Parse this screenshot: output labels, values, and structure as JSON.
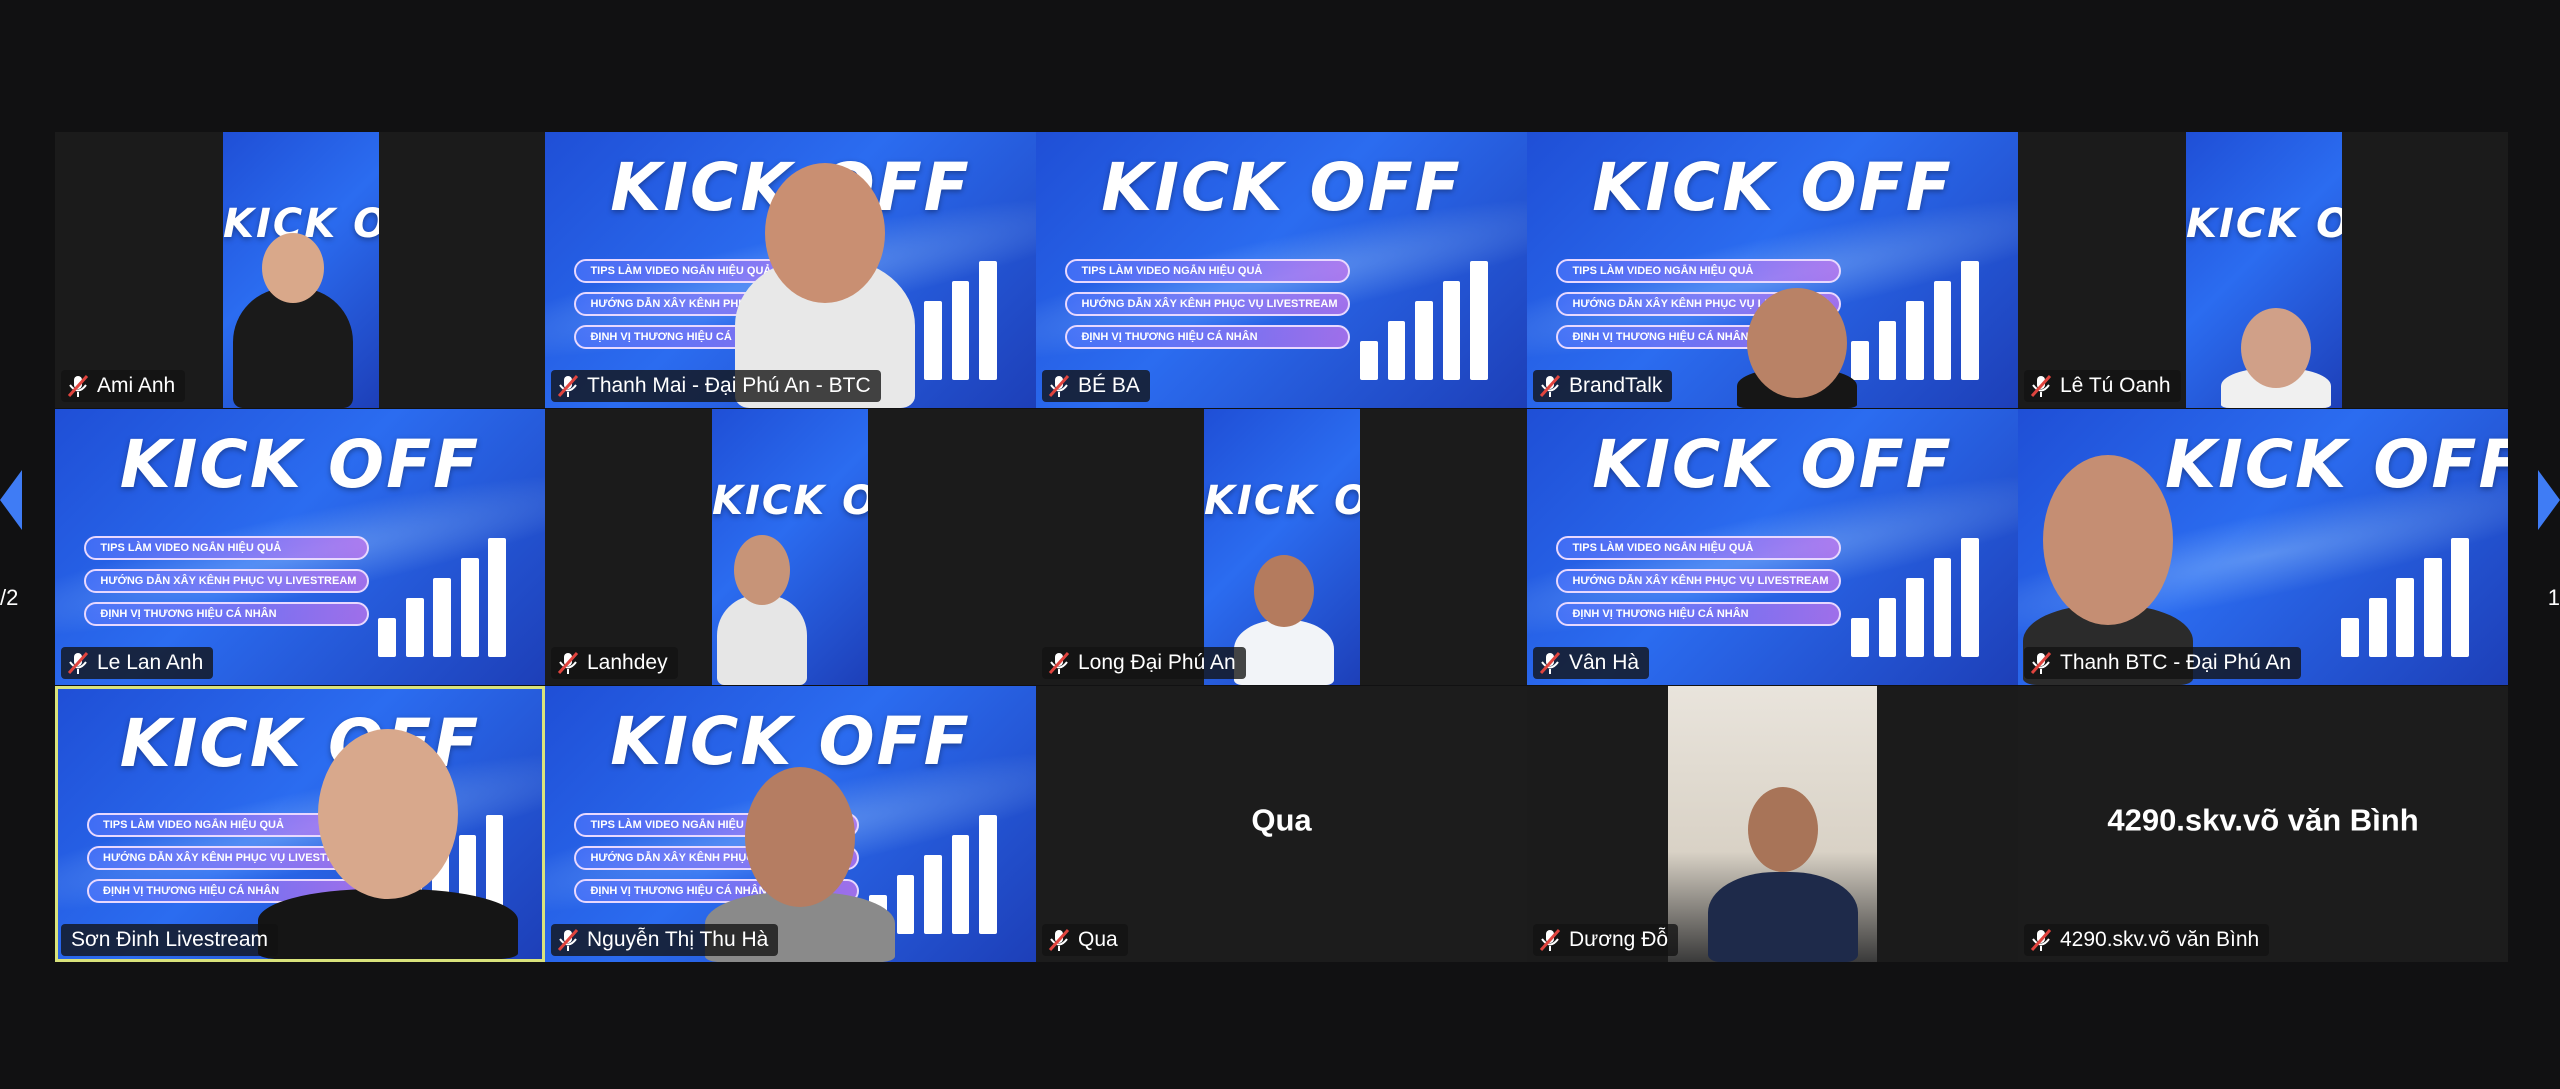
{
  "participants": [
    {
      "name": "Ami Anh",
      "muted": true,
      "video": true
    },
    {
      "name": "Thanh Mai - Đại Phú An - BTC",
      "muted": true,
      "video": true
    },
    {
      "name": "BÉ BA",
      "muted": true,
      "video": true
    },
    {
      "name": "BrandTalk",
      "muted": true,
      "video": true
    },
    {
      "name": "Lê Tú Oanh",
      "muted": true,
      "video": true
    },
    {
      "name": "Le Lan Anh",
      "muted": true,
      "video": true
    },
    {
      "name": "Lanhdey",
      "muted": true,
      "video": true
    },
    {
      "name": "Long Đại Phú An",
      "muted": true,
      "video": true
    },
    {
      "name": "Vân Hà",
      "muted": true,
      "video": true
    },
    {
      "name": "Thanh BTC - Đại Phú An",
      "muted": true,
      "video": true
    },
    {
      "name": "Sơn Đinh Livestream",
      "muted": false,
      "video": true,
      "speaking": true
    },
    {
      "name": "Nguyễn Thị Thu Hà",
      "muted": true,
      "video": true
    },
    {
      "name": "Qua",
      "muted": true,
      "video": false
    },
    {
      "name": "Dương Đỗ",
      "muted": true,
      "video": true
    },
    {
      "name": "4290.skv.võ văn Bình",
      "muted": true,
      "video": false
    }
  ],
  "slide": {
    "title": "KICK OFF",
    "items": [
      "TIPS LÀM VIDEO NGẮN HIỆU QUẢ",
      "HƯỚNG DẪN XÂY KÊNH PHỤC VỤ LIVESTREAM",
      "ĐỊNH VỊ THƯƠNG HIỆU CÁ NHÂN"
    ]
  },
  "pager": {
    "prev_label": "/2",
    "next_label": "1"
  },
  "colors": {
    "speaker_border": "#d9e37b",
    "mic_muted": "#e0443e",
    "background": "#111112"
  }
}
